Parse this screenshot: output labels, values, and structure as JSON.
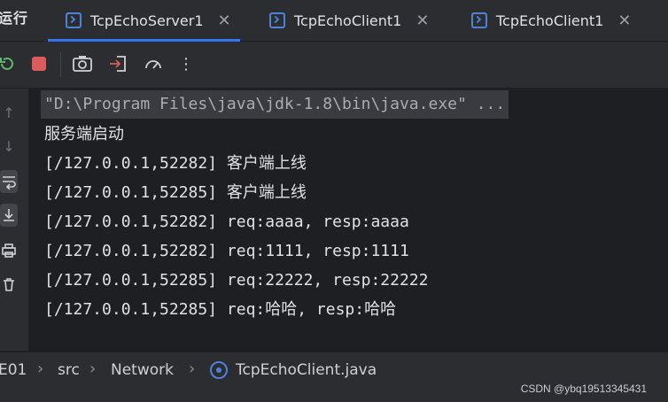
{
  "run_panel": {
    "title": "运行"
  },
  "tabs": [
    {
      "label": "TcpEchoServer1",
      "icon": "java-class-icon",
      "active": true
    },
    {
      "label": "TcpEchoClient1",
      "icon": "java-class-icon",
      "active": false
    },
    {
      "label": "TcpEchoClient1",
      "icon": "java-class-icon",
      "active": false
    }
  ],
  "toolbar": {
    "icons": [
      "rerun-icon",
      "stop-icon",
      "screenshot-icon",
      "exit-icon",
      "profiler-gauge-icon",
      "more-vertical-icon"
    ]
  },
  "gutter": {
    "icons": [
      "arrow-up-icon",
      "arrow-down-icon",
      "soft-wrap-icon",
      "scroll-to-end-icon",
      "print-icon",
      "trash-icon"
    ]
  },
  "console": {
    "command": "\"D:\\Program Files\\java\\jdk-1.8\\bin\\java.exe\" ...",
    "lines": [
      "服务端启动",
      "[/127.0.0.1,52282] 客户端上线",
      "[/127.0.0.1,52285] 客户端上线",
      "[/127.0.0.1,52282] req:aaaa, resp:aaaa",
      "[/127.0.0.1,52282] req:1111, resp:1111",
      "[/127.0.0.1,52285] req:22222, resp:22222",
      "[/127.0.0.1,52285] req:哈哈, resp:哈哈"
    ]
  },
  "breadcrumb": {
    "items": [
      "E01",
      "src",
      "Network",
      "TcpEchoClient.java"
    ]
  },
  "watermark": "CSDN @ybq19513345431",
  "colors": {
    "accent": "#3574f0",
    "stop": "#db5c5c",
    "background": "#1e1f22",
    "panel": "#2b2d30"
  }
}
